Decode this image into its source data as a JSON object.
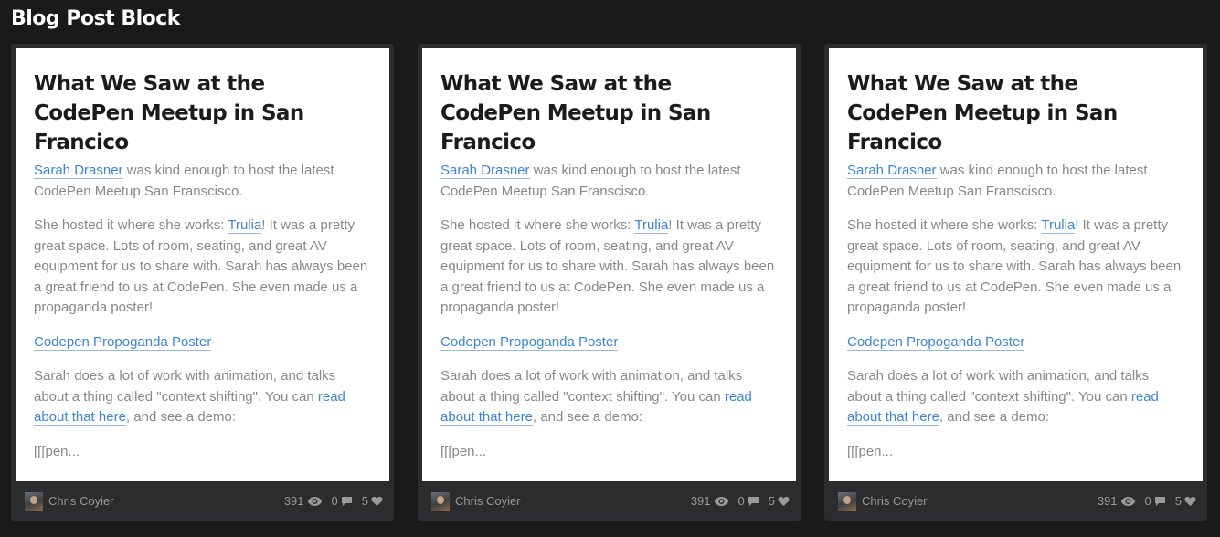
{
  "page": {
    "title": "Blog Post Block"
  },
  "cards": [
    {
      "title": "What We Saw at the CodePen Meetup in San Francico",
      "p1_link": "Sarah Drasner",
      "p1_text": " was kind enough to host the latest CodePen Meetup San Franscisco.",
      "p2_pre": "She hosted it where she works: ",
      "p2_link": "Trulia",
      "p2_post": "! It was a pretty great space. Lots of room, seating, and great AV equipment for us to share with. Sarah has always been a great friend to us at CodePen. She even made us a propaganda poster!",
      "p3_link": "Codepen Propoganda Poster",
      "p4_pre": "Sarah does a lot of work with animation, and talks about a thing called \"context shifting\". You can ",
      "p4_link": "read about that here",
      "p4_post": ", and see a demo:",
      "p5_text": "[[[pen...",
      "author": "Chris Coyier",
      "views": "391",
      "comments": "0",
      "likes": "5"
    },
    {
      "title": "What We Saw at the CodePen Meetup in San Francico",
      "p1_link": "Sarah Drasner",
      "p1_text": " was kind enough to host the latest CodePen Meetup San Franscisco.",
      "p2_pre": "She hosted it where she works: ",
      "p2_link": "Trulia",
      "p2_post": "! It was a pretty great space. Lots of room, seating, and great AV equipment for us to share with. Sarah has always been a great friend to us at CodePen. She even made us a propaganda poster!",
      "p3_link": "Codepen Propoganda Poster",
      "p4_pre": "Sarah does a lot of work with animation, and talks about a thing called \"context shifting\". You can ",
      "p4_link": "read about that here",
      "p4_post": ", and see a demo:",
      "p5_text": "[[[pen...",
      "author": "Chris Coyier",
      "views": "391",
      "comments": "0",
      "likes": "5"
    },
    {
      "title": "What We Saw at the CodePen Meetup in San Francico",
      "p1_link": "Sarah Drasner",
      "p1_text": " was kind enough to host the latest CodePen Meetup San Franscisco.",
      "p2_pre": "She hosted it where she works: ",
      "p2_link": "Trulia",
      "p2_post": "! It was a pretty great space. Lots of room, seating, and great AV equipment for us to share with. Sarah has always been a great friend to us at CodePen. She even made us a propaganda poster!",
      "p3_link": "Codepen Propoganda Poster",
      "p4_pre": "Sarah does a lot of work with animation, and talks about a thing called \"context shifting\". You can ",
      "p4_link": "read about that here",
      "p4_post": ", and see a demo:",
      "p5_text": "[[[pen...",
      "author": "Chris Coyier",
      "views": "391",
      "comments": "0",
      "likes": "5"
    }
  ],
  "icons": {
    "views": "eye-icon",
    "comments": "comment-icon",
    "likes": "heart-icon"
  },
  "colors": {
    "background": "#1a1a1a",
    "card_frame": "#2c2c2e",
    "link": "#3d85d6",
    "body_text": "#888888",
    "title_text": "#1b1b1b"
  }
}
